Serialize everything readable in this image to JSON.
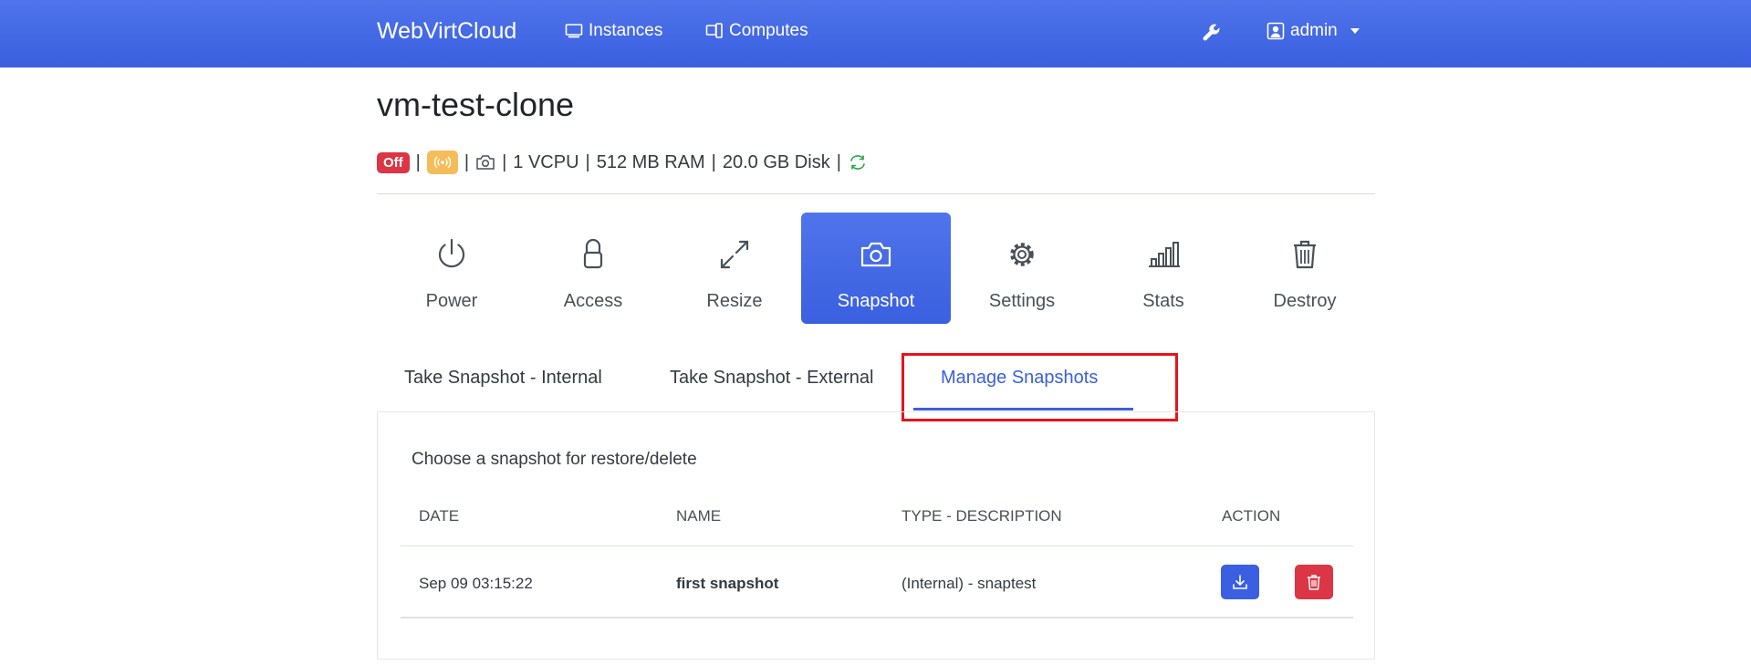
{
  "navbar": {
    "brand": "WebVirtCloud",
    "instances_label": "Instances",
    "computes_label": "Computes",
    "user_label": "admin"
  },
  "instance": {
    "name": "vm-test-clone",
    "status": "Off",
    "vcpu": "1 VCPU",
    "ram": "512 MB RAM",
    "disk": "20.0 GB Disk"
  },
  "actions": [
    {
      "label": "Power",
      "icon": "power-icon"
    },
    {
      "label": "Access",
      "icon": "lock-icon"
    },
    {
      "label": "Resize",
      "icon": "resize-icon"
    },
    {
      "label": "Snapshot",
      "icon": "camera-icon",
      "active": true
    },
    {
      "label": "Settings",
      "icon": "gear-icon"
    },
    {
      "label": "Stats",
      "icon": "bar-chart-icon"
    },
    {
      "label": "Destroy",
      "icon": "trash-icon"
    }
  ],
  "tabs": [
    {
      "label": "Take Snapshot - Internal"
    },
    {
      "label": "Take Snapshot - External"
    },
    {
      "label": "Manage Snapshots",
      "active": true
    }
  ],
  "manage": {
    "prompt": "Choose a snapshot for restore/delete",
    "columns": [
      "DATE",
      "NAME",
      "TYPE - DESCRIPTION",
      "ACTION"
    ],
    "rows": [
      {
        "date": "Sep 09 03:15:22",
        "name": "first snapshot",
        "type_description": "(Internal) - snaptest"
      }
    ]
  },
  "colors": {
    "primary": "#3a5fe0",
    "danger": "#dc3545",
    "warning": "#f5bd5a",
    "success": "#28a745",
    "highlight_box": "#e8131a"
  }
}
